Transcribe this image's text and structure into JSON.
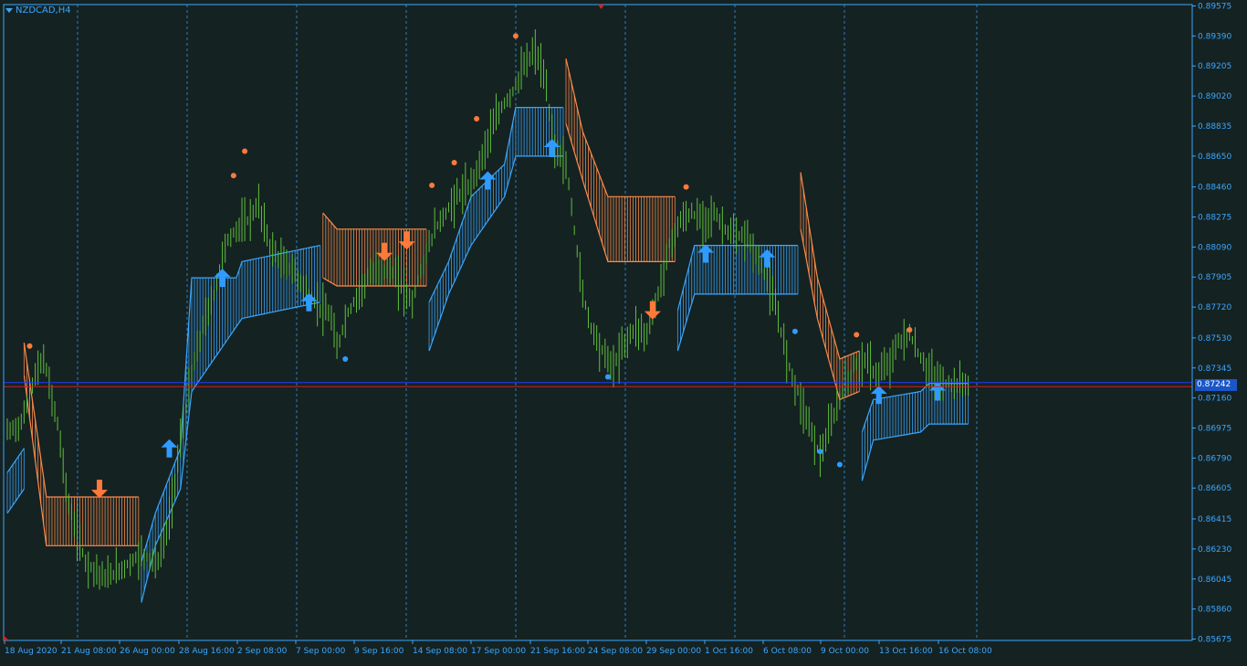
{
  "window": {
    "symbol_label": "NZDCAD,H4"
  },
  "current_price": "0.87242",
  "colors": {
    "background": "#152222",
    "frame": "#3aa7ff",
    "grid": "#2f8fd8",
    "bull_candle": "#5fbf3a",
    "band_up": "#3aa7ff",
    "band_down": "#ff8c4a",
    "arrow_up": "#2f9bff",
    "arrow_down": "#ff7a3a",
    "bid_line": "#1e3cff",
    "ask_line": "#d02020"
  },
  "chart_data": {
    "type": "candlestick",
    "symbol": "NZDCAD",
    "timeframe": "H4",
    "y_ticks": [
      "0.89575",
      "0.89390",
      "0.89205",
      "0.89020",
      "0.88835",
      "0.88650",
      "0.88460",
      "0.88275",
      "0.88090",
      "0.87905",
      "0.87720",
      "0.87530",
      "0.87345",
      "0.87160",
      "0.86975",
      "0.86790",
      "0.86605",
      "0.86415",
      "0.86230",
      "0.86045",
      "0.85860",
      "0.85675"
    ],
    "ylim": [
      0.85675,
      0.89575
    ],
    "x_labels": [
      "18 Aug 2020",
      "21 Aug 08:00",
      "26 Aug 00:00",
      "28 Aug 16:00",
      "2 Sep 08:00",
      "7 Sep 00:00",
      "9 Sep 16:00",
      "14 Sep 08:00",
      "17 Sep 00:00",
      "21 Sep 16:00",
      "24 Sep 08:00",
      "29 Sep 00:00",
      "1 Oct 16:00",
      "6 Oct 08:00",
      "9 Oct 00:00",
      "13 Oct 16:00",
      "16 Oct 08:00"
    ],
    "price_path": [
      [
        0,
        0.8695
      ],
      [
        5,
        0.87
      ],
      [
        10,
        0.873
      ],
      [
        13,
        0.874
      ],
      [
        18,
        0.87
      ],
      [
        22,
        0.865
      ],
      [
        28,
        0.8615
      ],
      [
        35,
        0.8605
      ],
      [
        42,
        0.8612
      ],
      [
        48,
        0.862
      ],
      [
        54,
        0.8615
      ],
      [
        58,
        0.864
      ],
      [
        62,
        0.869
      ],
      [
        66,
        0.873
      ],
      [
        70,
        0.876
      ],
      [
        74,
        0.878
      ],
      [
        78,
        0.881
      ],
      [
        82,
        0.882
      ],
      [
        86,
        0.8825
      ],
      [
        90,
        0.8835
      ],
      [
        94,
        0.881
      ],
      [
        98,
        0.88
      ],
      [
        102,
        0.8795
      ],
      [
        106,
        0.8785
      ],
      [
        110,
        0.8775
      ],
      [
        113,
        0.877
      ],
      [
        116,
        0.8765
      ],
      [
        118,
        0.8745
      ],
      [
        121,
        0.8765
      ],
      [
        125,
        0.8778
      ],
      [
        129,
        0.879
      ],
      [
        133,
        0.8795
      ],
      [
        137,
        0.8795
      ],
      [
        141,
        0.8785
      ],
      [
        145,
        0.8775
      ],
      [
        149,
        0.88
      ],
      [
        153,
        0.882
      ],
      [
        157,
        0.883
      ],
      [
        161,
        0.884
      ],
      [
        165,
        0.8845
      ],
      [
        169,
        0.886
      ],
      [
        173,
        0.888
      ],
      [
        177,
        0.8895
      ],
      [
        181,
        0.8905
      ],
      [
        185,
        0.892
      ],
      [
        189,
        0.893
      ],
      [
        192,
        0.8915
      ],
      [
        196,
        0.887
      ],
      [
        200,
        0.886
      ],
      [
        203,
        0.882
      ],
      [
        206,
        0.878
      ],
      [
        209,
        0.876
      ],
      [
        213,
        0.8745
      ],
      [
        217,
        0.8735
      ],
      [
        221,
        0.875
      ],
      [
        225,
        0.876
      ],
      [
        229,
        0.8755
      ],
      [
        233,
        0.878
      ],
      [
        237,
        0.881
      ],
      [
        241,
        0.8825
      ],
      [
        245,
        0.883
      ],
      [
        249,
        0.8825
      ],
      [
        253,
        0.883
      ],
      [
        257,
        0.882
      ],
      [
        261,
        0.8815
      ],
      [
        265,
        0.8815
      ],
      [
        269,
        0.88
      ],
      [
        272,
        0.879
      ],
      [
        276,
        0.8765
      ],
      [
        280,
        0.8735
      ],
      [
        283,
        0.872
      ],
      [
        287,
        0.87
      ],
      [
        291,
        0.868
      ],
      [
        295,
        0.87
      ],
      [
        299,
        0.872
      ],
      [
        303,
        0.8735
      ],
      [
        307,
        0.874
      ],
      [
        311,
        0.873
      ],
      [
        315,
        0.8735
      ],
      [
        319,
        0.875
      ],
      [
        323,
        0.8755
      ],
      [
        327,
        0.874
      ],
      [
        331,
        0.873
      ],
      [
        335,
        0.8725
      ]
    ],
    "band_segments": [
      {
        "dir": "up",
        "pts": [
          [
            0,
            0.8645,
            0.867
          ],
          [
            6,
            0.866,
            0.8685
          ]
        ]
      },
      {
        "dir": "down",
        "pts": [
          [
            6,
            0.873,
            0.875
          ],
          [
            14,
            0.8625,
            0.8655
          ],
          [
            47,
            0.8625,
            0.8655
          ]
        ]
      },
      {
        "dir": "up",
        "pts": [
          [
            48,
            0.859,
            0.8615
          ],
          [
            53,
            0.8625,
            0.8645
          ],
          [
            62,
            0.866,
            0.8685
          ],
          [
            66,
            0.872,
            0.879
          ],
          [
            82,
            0.876,
            0.879
          ],
          [
            84,
            0.8765,
            0.88
          ],
          [
            112,
            0.8775,
            0.881
          ]
        ]
      },
      {
        "dir": "down",
        "pts": [
          [
            113,
            0.879,
            0.883
          ],
          [
            118,
            0.8785,
            0.882
          ],
          [
            125,
            0.8785,
            0.882
          ],
          [
            150,
            0.8785,
            0.882
          ]
        ]
      },
      {
        "dir": "up",
        "pts": [
          [
            151,
            0.8745,
            0.8775
          ],
          [
            158,
            0.878,
            0.88
          ],
          [
            166,
            0.881,
            0.884
          ],
          [
            178,
            0.884,
            0.886
          ],
          [
            182,
            0.8865,
            0.8895
          ],
          [
            199,
            0.8865,
            0.8895
          ]
        ]
      },
      {
        "dir": "down",
        "pts": [
          [
            200,
            0.8885,
            0.8925
          ],
          [
            206,
            0.885,
            0.888
          ],
          [
            215,
            0.88,
            0.884
          ],
          [
            239,
            0.88,
            0.884
          ]
        ]
      },
      {
        "dir": "up",
        "pts": [
          [
            240,
            0.8745,
            0.877
          ],
          [
            246,
            0.878,
            0.881
          ],
          [
            283,
            0.878,
            0.881
          ]
        ]
      },
      {
        "dir": "down",
        "pts": [
          [
            284,
            0.882,
            0.8855
          ],
          [
            290,
            0.8765,
            0.879
          ],
          [
            298,
            0.8715,
            0.874
          ],
          [
            305,
            0.872,
            0.8745
          ]
        ]
      },
      {
        "dir": "up",
        "pts": [
          [
            306,
            0.8665,
            0.8695
          ],
          [
            310,
            0.869,
            0.8715
          ],
          [
            327,
            0.8695,
            0.872
          ],
          [
            330,
            0.87,
            0.8725
          ],
          [
            344,
            0.87,
            0.8725
          ]
        ]
      }
    ],
    "arrows": [
      {
        "dir": "down",
        "x": 33,
        "y": 0.866
      },
      {
        "dir": "up",
        "x": 58,
        "y": 0.8685
      },
      {
        "dir": "up",
        "x": 77,
        "y": 0.879
      },
      {
        "dir": "up",
        "x": 108,
        "y": 0.8775
      },
      {
        "dir": "down",
        "x": 135,
        "y": 0.8806
      },
      {
        "dir": "down",
        "x": 143,
        "y": 0.8813
      },
      {
        "dir": "up",
        "x": 172,
        "y": 0.885
      },
      {
        "dir": "up",
        "x": 195,
        "y": 0.887
      },
      {
        "dir": "down",
        "x": 231,
        "y": 0.877
      },
      {
        "dir": "up",
        "x": 250,
        "y": 0.8805
      },
      {
        "dir": "up",
        "x": 272,
        "y": 0.8802
      },
      {
        "dir": "up",
        "x": 312,
        "y": 0.8718
      },
      {
        "dir": "up",
        "x": 333,
        "y": 0.872
      }
    ],
    "dots": [
      {
        "dir": "high",
        "x": 8,
        "y": 0.8748
      },
      {
        "dir": "high",
        "x": 81,
        "y": 0.8853
      },
      {
        "dir": "high",
        "x": 85,
        "y": 0.8868
      },
      {
        "dir": "low",
        "x": 121,
        "y": 0.874
      },
      {
        "dir": "high",
        "x": 152,
        "y": 0.8847
      },
      {
        "dir": "high",
        "x": 160,
        "y": 0.8861
      },
      {
        "dir": "high",
        "x": 168,
        "y": 0.8888
      },
      {
        "dir": "high",
        "x": 182,
        "y": 0.8939
      },
      {
        "dir": "low",
        "x": 215,
        "y": 0.8729
      },
      {
        "dir": "high",
        "x": 243,
        "y": 0.8846
      },
      {
        "dir": "low",
        "x": 282,
        "y": 0.8757
      },
      {
        "dir": "low",
        "x": 291,
        "y": 0.8683
      },
      {
        "dir": "low",
        "x": 298,
        "y": 0.8675
      },
      {
        "dir": "high",
        "x": 304,
        "y": 0.8755
      },
      {
        "dir": "high",
        "x": 323,
        "y": 0.8758
      }
    ],
    "bid": 0.87255,
    "ask": 0.8723,
    "bar_count": 345
  }
}
